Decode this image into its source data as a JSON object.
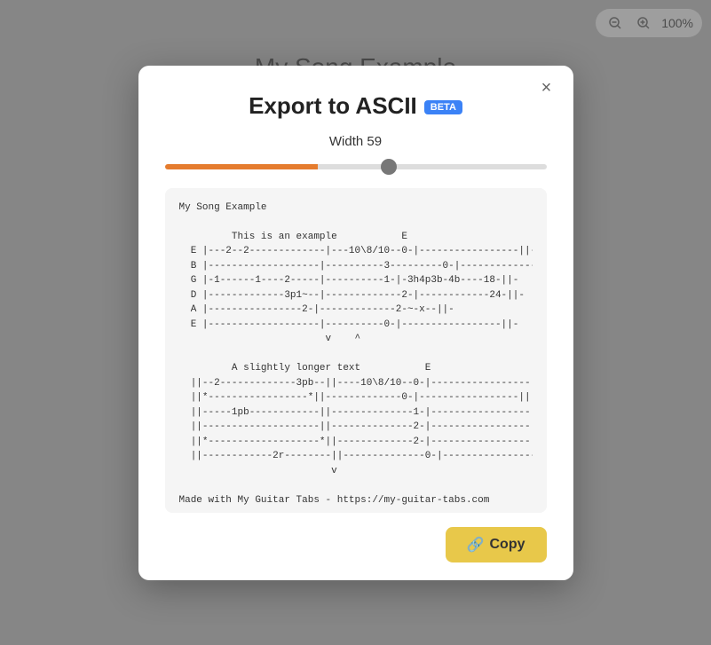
{
  "toolbar": {
    "zoom_out_label": "−",
    "zoom_in_label": "+",
    "zoom_level": "100%"
  },
  "background": {
    "title": "My Song Example"
  },
  "modal": {
    "title": "Export to ASCII",
    "beta_label": "BETA",
    "close_label": "×",
    "width_label": "Width 59",
    "slider_value": 59,
    "slider_min": 0,
    "slider_max": 100,
    "ascii_content": "My Song Example\n\n         This is an example           E\n  E |---2--2-------------|---10\\8/10--0-|-----------------||-\n  B |-------------------|----------3---------0-|-------------||-\n  G |-1------1----2-----|----------1-|-3h4p3b-4b----18-||-\n  D |-------------3p1~--|-------------2-|------------24-||-\n  A |----------------2-|-------------2-~-x--||-\n  E |-------------------|----------0-|-----------------||-\n                         v    ^\n\n         A slightly longer text           E\n  ||--2-------------3pb--||----10\\8/10--0-|-----------------||\n  ||*-----------------*||-------------0-|-----------------||\n  ||-----1pb------------||--------------1-|-----------------||\n  ||--------------------||--------------2-|-----------------||\n  ||*-------------------*||-------------2-|-----------------||\n  ||------------2r--------||--------------0-|-----------------||\n                          v\n\nMade with My Guitar Tabs - https://my-guitar-tabs.com",
    "copy_button_label": "Copy"
  }
}
